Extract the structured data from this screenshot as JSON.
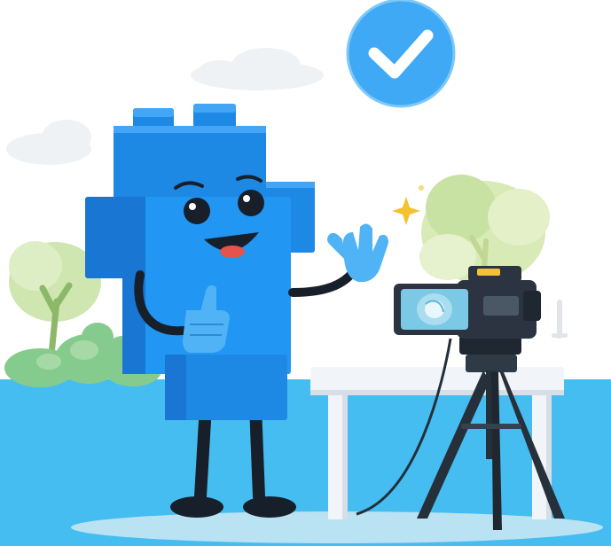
{
  "scene": {
    "subject": "blue-block-character-mascot",
    "icons": {
      "badge": "checkmark-icon",
      "sparkle": "sparkle-icon"
    },
    "colors": {
      "sky_blue": "#45BDF0",
      "mascot_blue": "#1E88E5",
      "mascot_light": "#42A5F5",
      "badge_blue": "#3FA9F5",
      "tree_green": "#B9DC8E",
      "bush_green": "#7FC68A",
      "camera_dark": "#2B3440",
      "table_white": "#F1F4F8",
      "ground_shadow": "#B9E2F3"
    }
  }
}
